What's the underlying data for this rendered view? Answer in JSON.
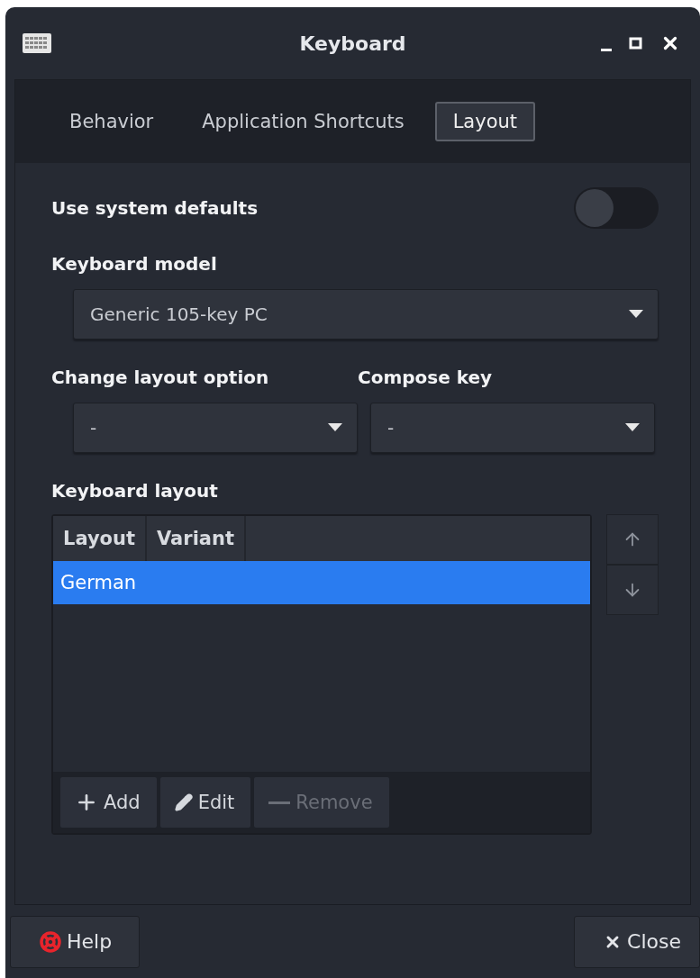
{
  "window": {
    "title": "Keyboard"
  },
  "tabs": [
    {
      "label": "Behavior",
      "selected": false
    },
    {
      "label": "Application Shortcuts",
      "selected": false
    },
    {
      "label": "Layout",
      "selected": true
    }
  ],
  "system_defaults": {
    "label": "Use system defaults",
    "on": false
  },
  "keyboard_model": {
    "label": "Keyboard model",
    "value": "Generic 105-key PC"
  },
  "change_layout_option": {
    "label": "Change layout option",
    "value": "-"
  },
  "compose_key": {
    "label": "Compose key",
    "value": "-"
  },
  "keyboard_layout": {
    "label": "Keyboard layout",
    "columns": [
      "Layout",
      "Variant"
    ],
    "rows": [
      {
        "cells": [
          "German"
        ],
        "selected": true
      }
    ],
    "actions": [
      {
        "kind": "add",
        "label": "Add",
        "disabled": false
      },
      {
        "kind": "edit",
        "label": "Edit",
        "disabled": false
      },
      {
        "kind": "remove",
        "label": "Remove",
        "disabled": true
      }
    ]
  },
  "buttons": [
    {
      "kind": "help",
      "label": "Help"
    },
    {
      "kind": "close",
      "label": "Close"
    }
  ]
}
